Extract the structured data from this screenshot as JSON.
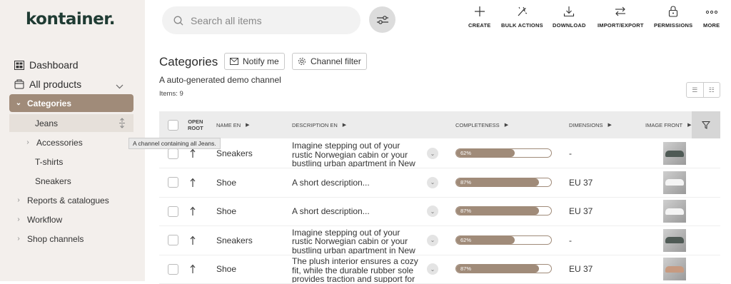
{
  "app": {
    "logo": "kontainer."
  },
  "sidebar": {
    "items": [
      {
        "label": "Dashboard",
        "icon": "dashboard-icon"
      },
      {
        "label": "All products",
        "icon": "box-icon"
      }
    ],
    "tree": [
      {
        "label": "Categories",
        "chevron": "down"
      },
      {
        "label": "Jeans",
        "chevron": ""
      },
      {
        "label": "Accessories",
        "chevron": "right"
      },
      {
        "label": "T-shirts",
        "chevron": ""
      },
      {
        "label": "Sneakers",
        "chevron": ""
      },
      {
        "label": "Reports & catalogues",
        "chevron": "right"
      },
      {
        "label": "Workflow",
        "chevron": "right"
      },
      {
        "label": "Shop channels",
        "chevron": "right"
      }
    ],
    "tooltip": "A channel containing all Jeans."
  },
  "search": {
    "placeholder": "Search all items"
  },
  "toolbar": {
    "create": "CREATE",
    "bulk": "BULK ACTIONS",
    "download": "DOWNLOAD",
    "import": "IMPORT/EXPORT",
    "permissions": "PERMISSIONS",
    "more": "MORE"
  },
  "main": {
    "title": "Categories",
    "notify": "Notify me",
    "channel_filter": "Channel filter",
    "description": "A auto-generated demo channel",
    "items_count": "Items: 9"
  },
  "table": {
    "columns": {
      "open_root_1": "OPEN",
      "open_root_2": "ROOT",
      "name": "NAME EN",
      "description": "DESCRIPTION EN",
      "completeness": "COMPLETENESS",
      "dimensions": "DIMENSIONS",
      "image": "IMAGE FRONT"
    },
    "rows": [
      {
        "name": "Sneakers",
        "description": "Imagine stepping out of your rustic Norwegian cabin or your bustling urban apartment in New",
        "completeness": "62%",
        "completeness_value": 62,
        "dimensions": "-",
        "shoe_color": "#4f5a55"
      },
      {
        "name": "Shoe",
        "description": "A short description...",
        "completeness": "87%",
        "completeness_value": 87,
        "dimensions": "EU 37",
        "shoe_color": "#f4f4f4"
      },
      {
        "name": "Shoe",
        "description": "A short description...",
        "completeness": "87%",
        "completeness_value": 87,
        "dimensions": "EU 37",
        "shoe_color": "#f4f4f4"
      },
      {
        "name": "Sneakers",
        "description": "Imagine stepping out of your rustic Norwegian cabin or your bustling urban apartment in New",
        "completeness": "62%",
        "completeness_value": 62,
        "dimensions": "-",
        "shoe_color": "#4f5a55"
      },
      {
        "name": "Shoe",
        "description": "The plush interior ensures a cozy fit, while the durable rubber sole provides traction and support for",
        "completeness": "87%",
        "completeness_value": 87,
        "dimensions": "EU 37",
        "shoe_color": "#c79a80"
      }
    ]
  },
  "colors": {
    "accent": "#a08b79",
    "sidebar_bg": "#f3efec",
    "logo": "#1f3b33"
  }
}
